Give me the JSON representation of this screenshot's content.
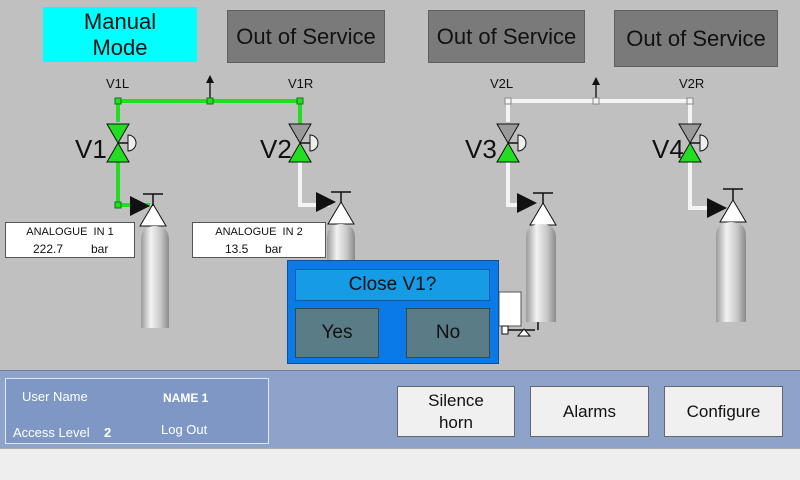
{
  "header": {
    "mode_label": "Manual\nMode",
    "status_buttons": [
      "Out of Service",
      "Out of Service",
      "Out of Service"
    ]
  },
  "valves": {
    "sides": [
      "V1L",
      "V1R",
      "V2L",
      "V2R"
    ],
    "names": [
      "V1",
      "V2",
      "V3",
      "V4"
    ]
  },
  "readouts": [
    {
      "title": "ANALOGUE  IN 1",
      "value": "222.7",
      "unit": "bar"
    },
    {
      "title": "ANALOGUE  IN 2",
      "value": "13.5",
      "unit": "bar"
    }
  ],
  "dialog": {
    "title": "Close V1?",
    "yes": "Yes",
    "no": "No"
  },
  "user": {
    "name_label": "User Name",
    "name_value": "NAME 1",
    "access_label": "Access Level",
    "access_value": "2",
    "logout": "Log Out"
  },
  "toolbar": {
    "silence": "Silence\nhorn",
    "alarms": "Alarms",
    "configure": "Configure"
  },
  "colors": {
    "active_green": "#22dd22",
    "inactive_white": "#f4f4f4",
    "mode_cyan": "#00ffff",
    "dialog_blue": "#0a7ae8"
  }
}
